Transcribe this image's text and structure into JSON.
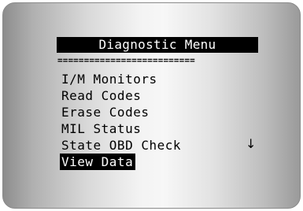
{
  "screen": {
    "title": "Diagnostic Menu",
    "divider": "==========================",
    "menu": {
      "items": [
        {
          "label": "I/M Monitors",
          "selected": false
        },
        {
          "label": "Read Codes",
          "selected": false
        },
        {
          "label": "Erase Codes",
          "selected": false
        },
        {
          "label": "MIL Status",
          "selected": false
        },
        {
          "label": "State OBD Check",
          "selected": false
        },
        {
          "label": "View Data",
          "selected": true
        }
      ]
    },
    "scroll_indicator": "↓",
    "scroll_icon": "down-arrow-icon"
  },
  "colors": {
    "highlight_bg": "#000000",
    "highlight_fg": "#ffffff",
    "text": "#000000"
  }
}
